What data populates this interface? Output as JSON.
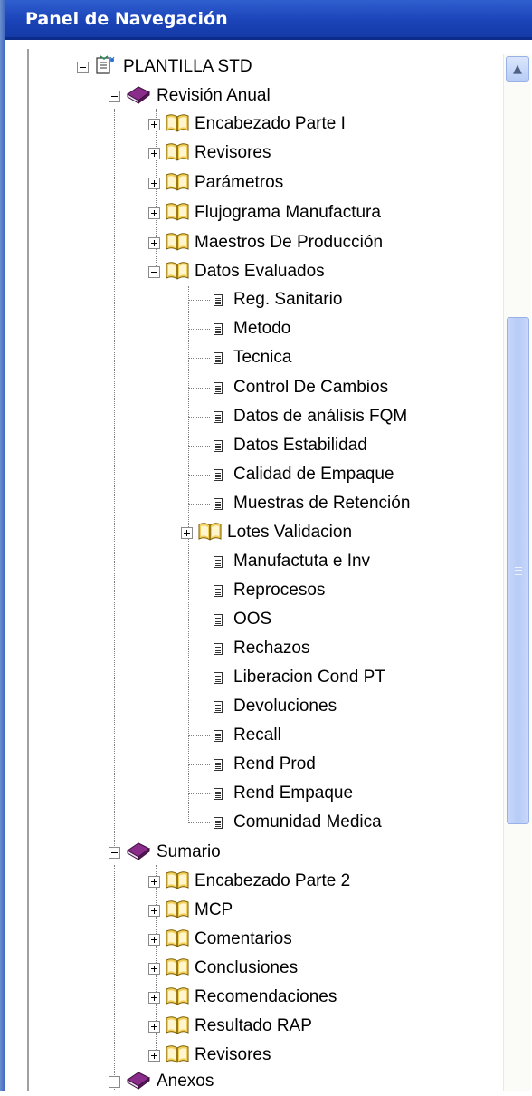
{
  "panel": {
    "title": "Panel de Navegación"
  },
  "colors": {
    "titlebar": "#1b44b8",
    "book_closed": "#7a1f7a",
    "book_open": "#e8c04a",
    "scrollbar_thumb": "#b6cbf6"
  },
  "tree": {
    "root": {
      "label": "PLANTILLA STD",
      "icon": "template-document-icon",
      "expanded": true
    },
    "revision_anual": {
      "label": "Revisión Anual",
      "icon": "closed-book-icon",
      "expanded": true,
      "children": [
        {
          "label": "Encabezado Parte I",
          "icon": "open-book-icon",
          "expanded": false
        },
        {
          "label": "Revisores",
          "icon": "open-book-icon",
          "expanded": false
        },
        {
          "label": "Parámetros",
          "icon": "open-book-icon",
          "expanded": false
        },
        {
          "label": "Flujograma Manufactura",
          "icon": "open-book-icon",
          "expanded": false
        },
        {
          "label": "Maestros De Producción",
          "icon": "open-book-icon",
          "expanded": false
        },
        {
          "label": "Datos Evaluados",
          "icon": "open-book-icon",
          "expanded": true
        }
      ]
    },
    "datos_evaluados": {
      "children": [
        {
          "label": "Reg. Sanitario",
          "icon": "document-icon"
        },
        {
          "label": "Metodo",
          "icon": "document-icon"
        },
        {
          "label": "Tecnica",
          "icon": "document-icon"
        },
        {
          "label": "Control De Cambios",
          "icon": "document-icon"
        },
        {
          "label": "Datos de análisis FQM",
          "icon": "document-icon"
        },
        {
          "label": "Datos Estabilidad",
          "icon": "document-icon"
        },
        {
          "label": "Calidad de Empaque",
          "icon": "document-icon"
        },
        {
          "label": "Muestras de Retención",
          "icon": "document-icon"
        },
        {
          "label": "Lotes Validacion",
          "icon": "open-book-icon",
          "expanded": false
        },
        {
          "label": "Manufactuta e Inv",
          "icon": "document-icon"
        },
        {
          "label": "Reprocesos",
          "icon": "document-icon"
        },
        {
          "label": "OOS",
          "icon": "document-icon"
        },
        {
          "label": "Rechazos",
          "icon": "document-icon"
        },
        {
          "label": "Liberacion Cond PT",
          "icon": "document-icon"
        },
        {
          "label": "Devoluciones",
          "icon": "document-icon"
        },
        {
          "label": "Recall",
          "icon": "document-icon"
        },
        {
          "label": "Rend Prod",
          "icon": "document-icon"
        },
        {
          "label": "Rend Empaque",
          "icon": "document-icon"
        },
        {
          "label": "Comunidad Medica",
          "icon": "document-icon"
        }
      ]
    },
    "sumario": {
      "label": "Sumario",
      "icon": "closed-book-icon",
      "expanded": true,
      "children": [
        {
          "label": "Encabezado Parte 2",
          "icon": "open-book-icon",
          "expanded": false
        },
        {
          "label": "MCP",
          "icon": "open-book-icon",
          "expanded": false
        },
        {
          "label": "Comentarios",
          "icon": "open-book-icon",
          "expanded": false
        },
        {
          "label": "Conclusiones",
          "icon": "open-book-icon",
          "expanded": false
        },
        {
          "label": "Recomendaciones",
          "icon": "open-book-icon",
          "expanded": false
        },
        {
          "label": "Resultado RAP",
          "icon": "open-book-icon",
          "expanded": false
        },
        {
          "label": "Revisores",
          "icon": "open-book-icon",
          "expanded": false
        }
      ]
    },
    "anexos": {
      "label": "Anexos",
      "icon": "closed-book-icon",
      "expanded": true
    }
  }
}
